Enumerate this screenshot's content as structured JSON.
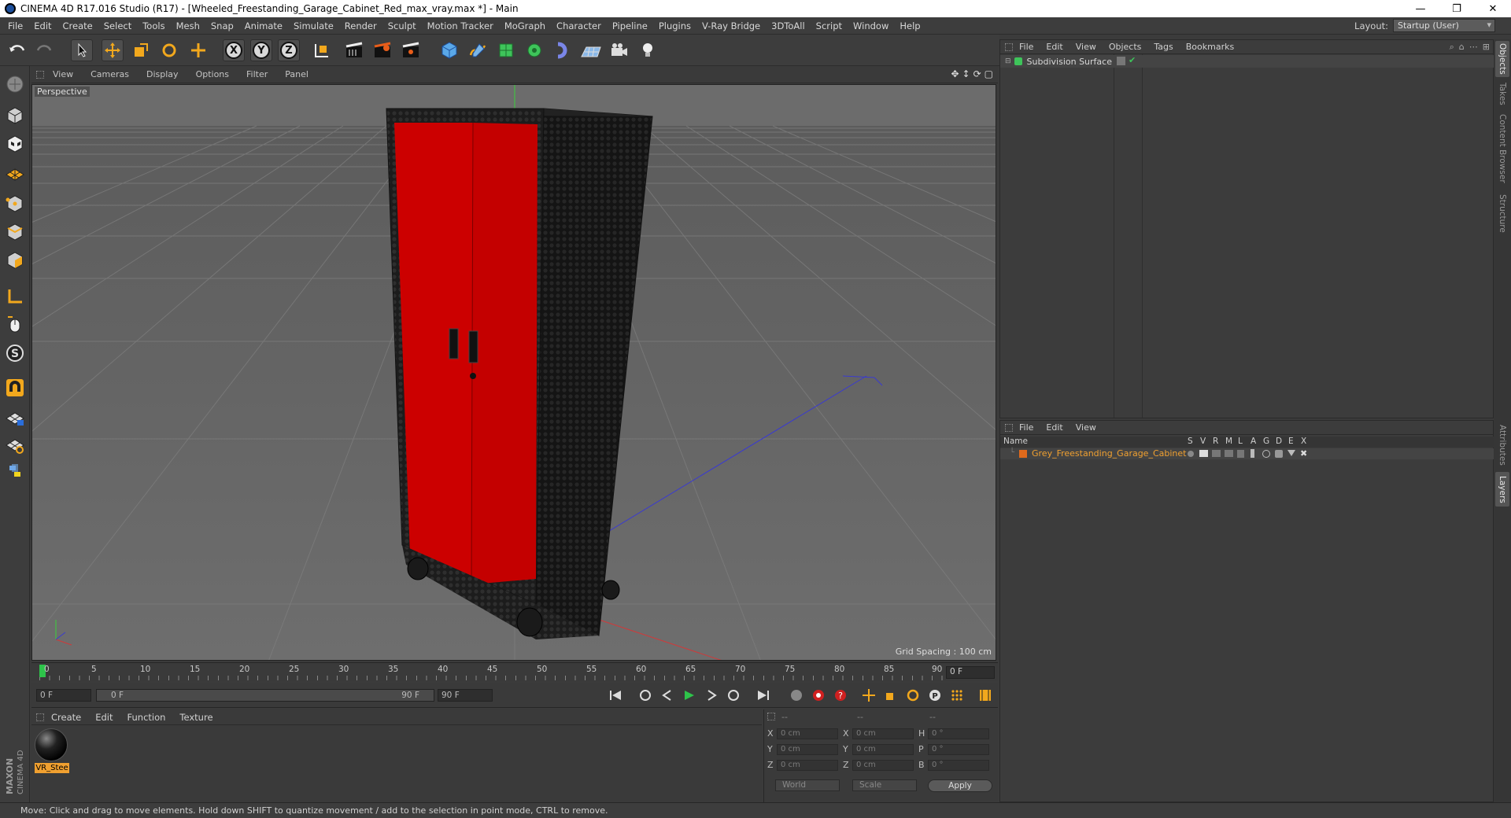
{
  "window": {
    "title": "CINEMA 4D R17.016 Studio (R17) - [Wheeled_Freestanding_Garage_Cabinet_Red_max_vray.max *] - Main",
    "minimize": "—",
    "restore": "❐",
    "close": "✕"
  },
  "menubar": {
    "items": [
      "File",
      "Edit",
      "Create",
      "Select",
      "Tools",
      "Mesh",
      "Snap",
      "Animate",
      "Simulate",
      "Render",
      "Sculpt",
      "Motion Tracker",
      "MoGraph",
      "Character",
      "Pipeline",
      "Plugins",
      "V-Ray Bridge",
      "3DToAll",
      "Script",
      "Window",
      "Help"
    ],
    "layout_label": "Layout:",
    "layout_value": "Startup (User)"
  },
  "toolbar": {
    "axis_x": "X",
    "axis_y": "Y",
    "axis_z": "Z"
  },
  "viewport": {
    "menu": [
      "View",
      "Cameras",
      "Display",
      "Options",
      "Filter",
      "Panel"
    ],
    "label": "Perspective",
    "grid_spacing": "Grid Spacing : 100 cm"
  },
  "timeline": {
    "ticks": [
      "0",
      "5",
      "10",
      "15",
      "20",
      "25",
      "30",
      "35",
      "40",
      "45",
      "50",
      "55",
      "60",
      "65",
      "70",
      "75",
      "80",
      "85",
      "90"
    ],
    "current_frame": "0 F",
    "start_field": "0 F",
    "range_start": "0 F",
    "range_end": "90 F",
    "end_field": "90 F"
  },
  "material_panel": {
    "menu": [
      "Create",
      "Edit",
      "Function",
      "Texture"
    ],
    "materials": [
      {
        "name": "VR_Stee"
      }
    ]
  },
  "coord_panel": {
    "header": [
      "--",
      "--",
      "--"
    ],
    "rows": [
      {
        "a": "X",
        "av": "0 cm",
        "b": "X",
        "bv": "0 cm",
        "c": "H",
        "cv": "0 °"
      },
      {
        "a": "Y",
        "av": "0 cm",
        "b": "Y",
        "bv": "0 cm",
        "c": "P",
        "cv": "0 °"
      },
      {
        "a": "Z",
        "av": "0 cm",
        "b": "Z",
        "bv": "0 cm",
        "c": "B",
        "cv": "0 °"
      }
    ],
    "world": "World",
    "scale": "Scale",
    "apply": "Apply"
  },
  "object_manager": {
    "menu": [
      "File",
      "Edit",
      "View",
      "Objects",
      "Tags",
      "Bookmarks"
    ],
    "objects": [
      {
        "name": "Subdivision Surface"
      }
    ]
  },
  "layer_manager": {
    "menu": [
      "File",
      "Edit",
      "View"
    ],
    "columns": [
      "Name",
      "S",
      "V",
      "R",
      "M",
      "L",
      "A",
      "G",
      "D",
      "E",
      "X"
    ],
    "layers": [
      {
        "name": "Grey_Freestanding_Garage_Cabinet",
        "color": "#e06a1c"
      }
    ]
  },
  "side_tabs": [
    "Objects",
    "Takes",
    "Content Browser",
    "Structure",
    "Attributes",
    "Layers"
  ],
  "branding": "MAXON CINEMA 4D",
  "status": "Move: Click and drag to move elements. Hold down SHIFT to quantize movement / add to the selection in point mode, CTRL to remove.",
  "colors": {
    "door_red": "#cc0000",
    "cabinet_black": "#1a1a1a",
    "accent_orange": "#f0a030",
    "viewport_bg": "#6a6a6a"
  }
}
